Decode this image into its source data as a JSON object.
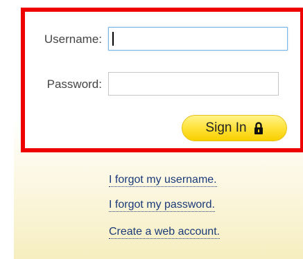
{
  "login_form": {
    "username_label": "Username:",
    "username_value": "",
    "password_label": "Password:",
    "password_value": "",
    "sign_in_label": "Sign In",
    "sign_in_icon": "lock-icon",
    "highlight_color": "#ee0000",
    "button_color": "#ffe23a"
  },
  "links": {
    "forgot_username": "I forgot my username.",
    "forgot_password": "I forgot my password.",
    "create_account": "Create a web account."
  }
}
